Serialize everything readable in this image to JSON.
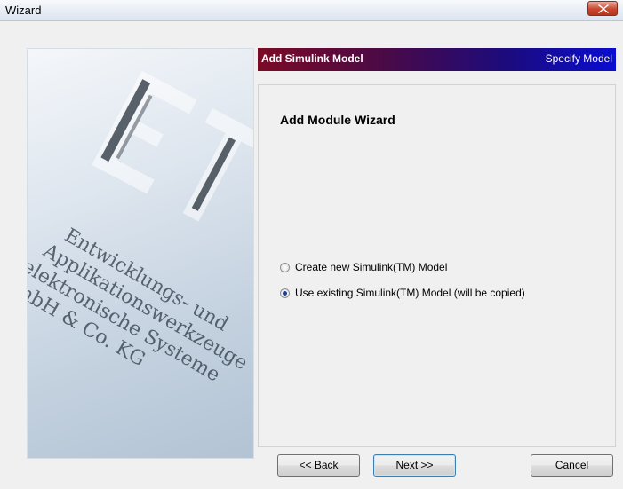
{
  "window": {
    "title": "Wizard",
    "close_icon": "close-icon"
  },
  "header": {
    "title": "Add Simulink Model",
    "step": "Specify Model"
  },
  "content": {
    "heading": "Add Module Wizard",
    "options": [
      {
        "label": "Create new Simulink(TM) Model",
        "checked": false
      },
      {
        "label": "Use existing Simulink(TM) Model (will be copied)",
        "checked": true
      }
    ]
  },
  "art": {
    "lines": [
      "Entwicklungs- und",
      "Applikationswerkzeuge",
      "elektronische Systeme",
      "GmbH & Co. KG"
    ]
  },
  "buttons": {
    "back": "<< Back",
    "next": "Next >>",
    "cancel": "Cancel"
  }
}
